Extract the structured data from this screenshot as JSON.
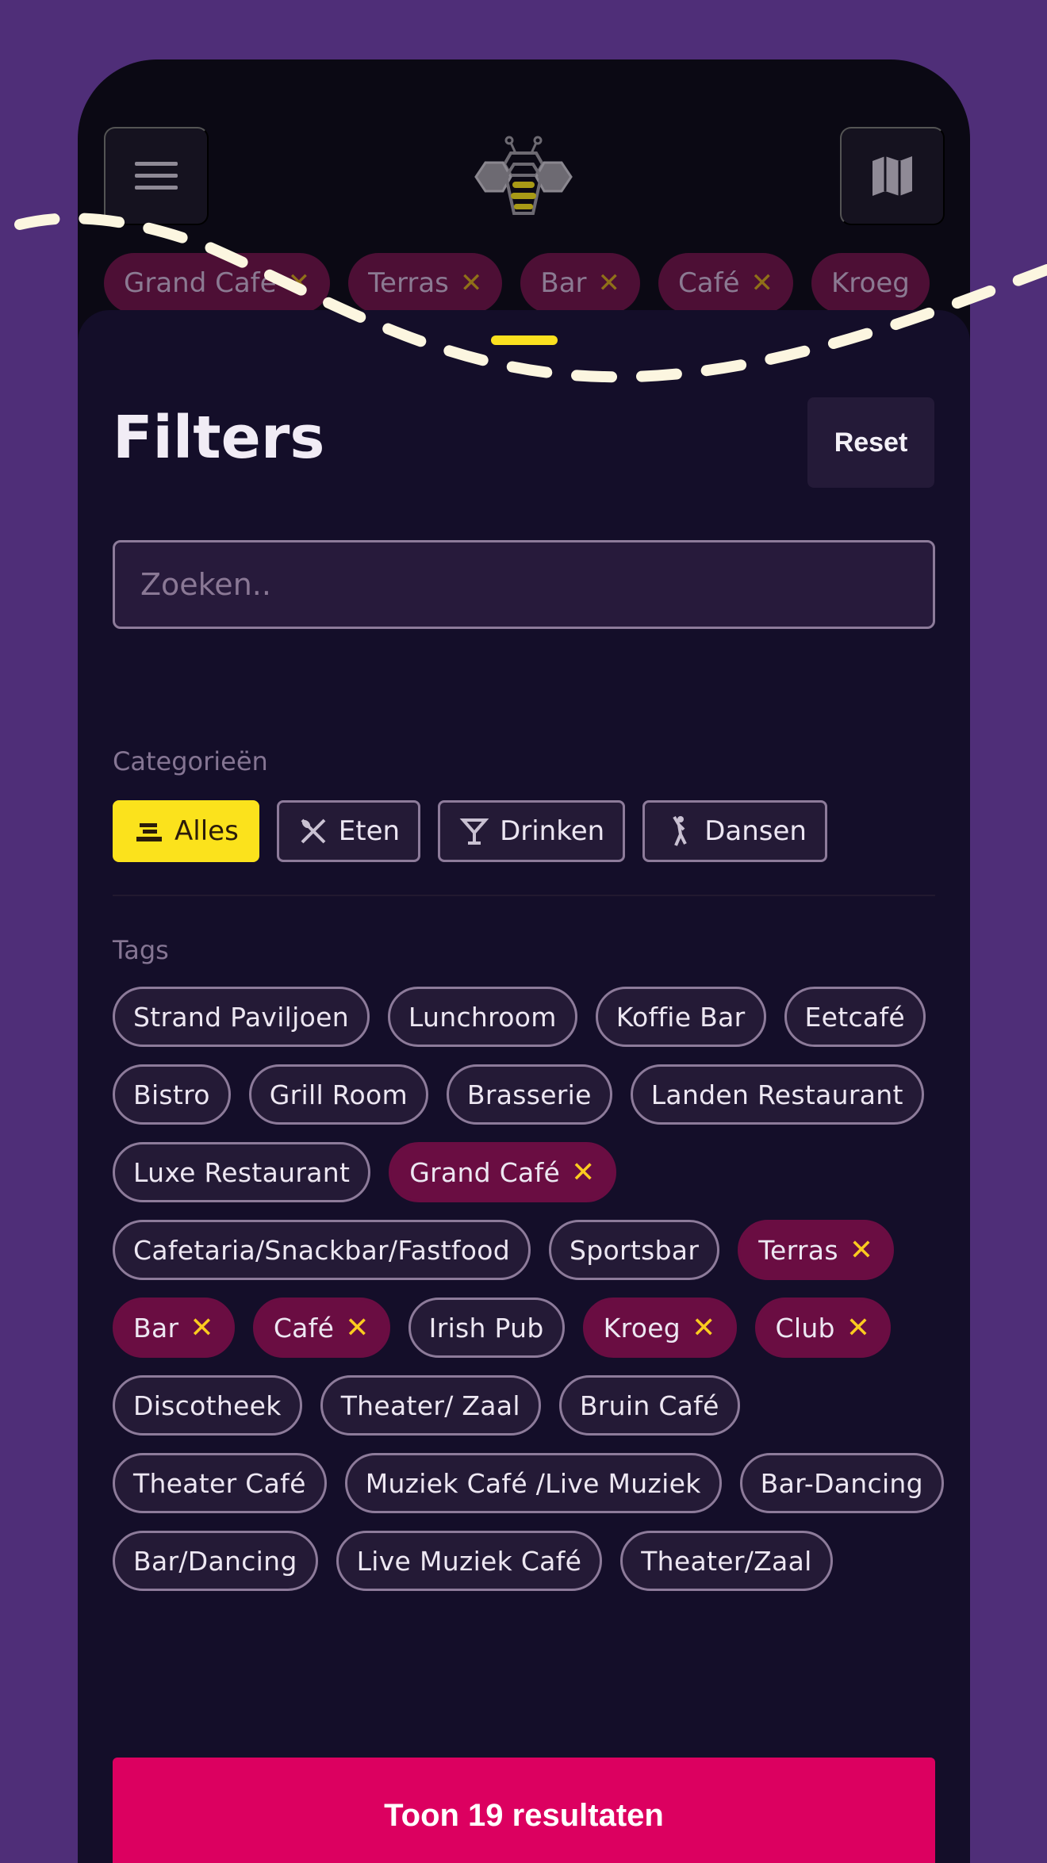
{
  "header": {
    "menu_icon": "menu-icon",
    "logo": "bee-logo",
    "map_icon": "map-icon"
  },
  "active_filters": [
    {
      "label": "Grand Café"
    },
    {
      "label": "Terras"
    },
    {
      "label": "Bar"
    },
    {
      "label": "Café"
    },
    {
      "label": "Kroeg"
    }
  ],
  "filters": {
    "title": "Filters",
    "reset_label": "Reset",
    "search_placeholder": "Zoeken..",
    "categories_label": "Categorieën",
    "categories": [
      {
        "label": "Alles",
        "icon": "all-icon",
        "active": true
      },
      {
        "label": "Eten",
        "icon": "fork-knife-icon",
        "active": false
      },
      {
        "label": "Drinken",
        "icon": "cocktail-icon",
        "active": false
      },
      {
        "label": "Dansen",
        "icon": "dancer-icon",
        "active": false
      }
    ],
    "tags_label": "Tags",
    "tags": [
      {
        "label": "Strand Paviljoen",
        "selected": false
      },
      {
        "label": "Lunchroom",
        "selected": false
      },
      {
        "label": "Koffie Bar",
        "selected": false
      },
      {
        "label": "Eetcafé",
        "selected": false
      },
      {
        "label": "Bistro",
        "selected": false
      },
      {
        "label": "Grill Room",
        "selected": false
      },
      {
        "label": "Brasserie",
        "selected": false
      },
      {
        "label": "Landen Restaurant",
        "selected": false
      },
      {
        "label": "Luxe Restaurant",
        "selected": false
      },
      {
        "label": "Grand Café",
        "selected": true
      },
      {
        "label": "Cafetaria/Snackbar/Fastfood",
        "selected": false
      },
      {
        "label": "Sportsbar",
        "selected": false
      },
      {
        "label": "Terras",
        "selected": true
      },
      {
        "label": "Bar",
        "selected": true
      },
      {
        "label": "Café",
        "selected": true
      },
      {
        "label": "Irish Pub",
        "selected": false
      },
      {
        "label": "Kroeg",
        "selected": true
      },
      {
        "label": "Club",
        "selected": true
      },
      {
        "label": "Discotheek",
        "selected": false
      },
      {
        "label": "Theater/ Zaal",
        "selected": false
      },
      {
        "label": "Bruin Café",
        "selected": false
      },
      {
        "label": "Theater Café",
        "selected": false
      },
      {
        "label": "Muziek Café /Live Muziek",
        "selected": false
      },
      {
        "label": "Bar-Dancing",
        "selected": false
      },
      {
        "label": "Bar/Dancing",
        "selected": false
      },
      {
        "label": "Live Muziek Café",
        "selected": false
      },
      {
        "label": "Theater/Zaal",
        "selected": false
      }
    ],
    "show_results_label": "Toon 19 resultaten"
  },
  "colors": {
    "background": "#4f2e78",
    "accent_yellow": "#fbe21c",
    "selected_tag": "#6a0d42",
    "cta": "#dc0060"
  }
}
